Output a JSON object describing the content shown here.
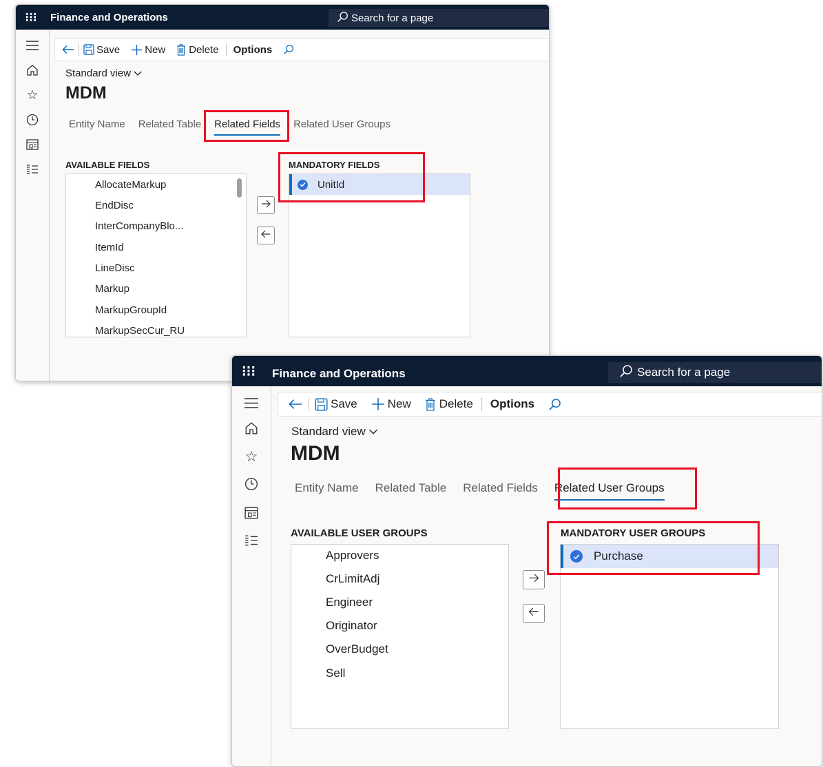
{
  "screens": [
    {
      "app_title": "Finance and Operations",
      "search_placeholder": "Search for a page",
      "actions": {
        "save": "Save",
        "new": "New",
        "delete": "Delete",
        "options": "Options"
      },
      "view_name": "Standard view",
      "page_title": "MDM",
      "tabs": [
        "Entity Name",
        "Related Table",
        "Related Fields",
        "Related User Groups"
      ],
      "active_tab": "Related Fields",
      "available_label": "AVAILABLE FIELDS",
      "available_items": [
        "AllocateMarkup",
        "EndDisc",
        "InterCompanyBlo...",
        "ItemId",
        "LineDisc",
        "Markup",
        "MarkupGroupId",
        "MarkupSecCur_RU"
      ],
      "mandatory_label": "MANDATORY FIELDS",
      "mandatory_items": [
        "UnitId"
      ]
    },
    {
      "app_title": "Finance and Operations",
      "search_placeholder": "Search for a page",
      "actions": {
        "save": "Save",
        "new": "New",
        "delete": "Delete",
        "options": "Options"
      },
      "view_name": "Standard view",
      "page_title": "MDM",
      "tabs": [
        "Entity Name",
        "Related Table",
        "Related Fields",
        "Related User Groups"
      ],
      "active_tab": "Related User Groups",
      "available_label": "AVAILABLE USER GROUPS",
      "available_items": [
        "Approvers",
        "CrLimitAdj",
        "Engineer",
        "Originator",
        "OverBudget",
        "Sell"
      ],
      "mandatory_label": "MANDATORY USER GROUPS",
      "mandatory_items": [
        "Purchase"
      ]
    }
  ],
  "icons": {
    "waffle": "waffle-icon",
    "menu": "hamburger-icon",
    "home": "home-icon",
    "favorites": "star-icon",
    "recent": "clock-icon",
    "workspaces": "workspace-icon",
    "modules": "list-icon",
    "back": "back-arrow-icon",
    "save": "save-icon",
    "new": "plus-icon",
    "delete": "trash-icon",
    "search": "search-icon",
    "add": "arrow-right-icon",
    "remove": "arrow-left-icon",
    "check": "check-circle-icon"
  },
  "colors": {
    "topbar": "#0c1c33",
    "accent": "#0f6cbd",
    "highlight": "#e81123",
    "selected_row": "#dbe4f8"
  }
}
